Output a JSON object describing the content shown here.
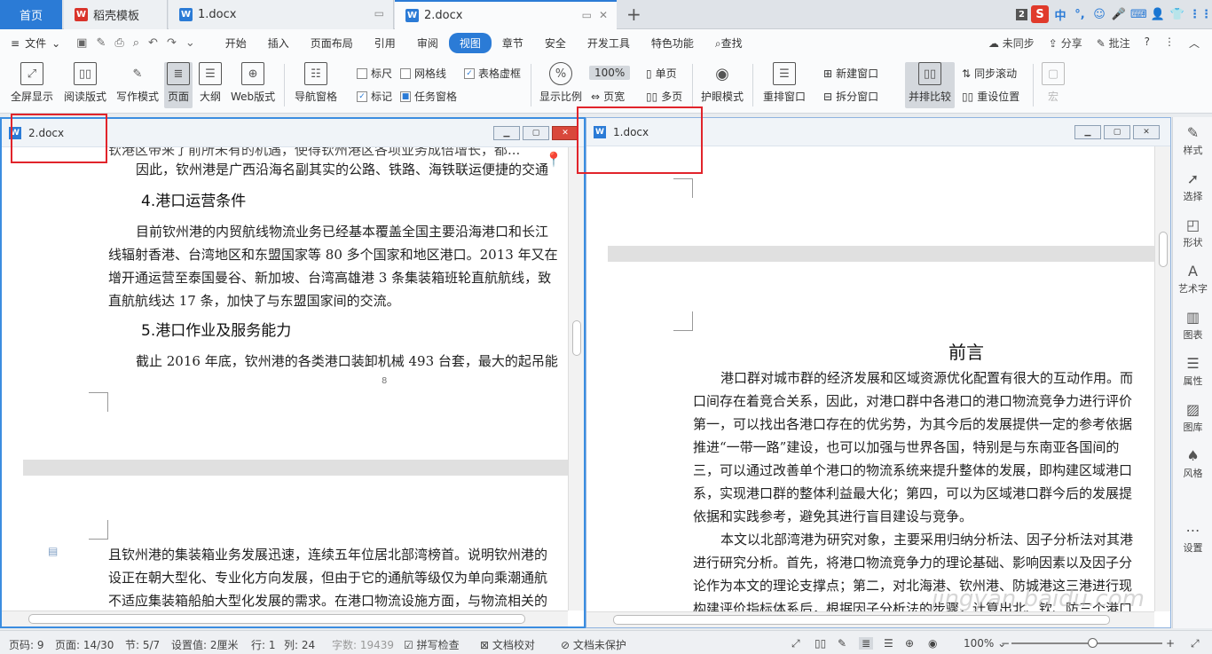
{
  "tabs": {
    "home": "首页",
    "template": "稻壳模板",
    "doc1": "1.docx",
    "doc2": "2.docx",
    "add": "+"
  },
  "tray": {
    "count": "2",
    "s": "S",
    "zh": "中",
    "punct": "°,",
    "emoji": "☺",
    "mic": "🎤",
    "kb": "⌨",
    "user": "👤",
    "shirt": "👕",
    "grid": "⋮⋮"
  },
  "menubar": {
    "file": "文件",
    "items": [
      "开始",
      "插入",
      "页面布局",
      "引用",
      "审阅",
      "视图",
      "章节",
      "安全",
      "开发工具",
      "特色功能"
    ],
    "search": "查找",
    "sync": "未同步",
    "share": "分享",
    "comment": "批注",
    "help": "?"
  },
  "ribbon": {
    "fullscreen": "全屏显示",
    "reading": "阅读版式",
    "writing": "写作模式",
    "page": "页面",
    "outline": "大纲",
    "web": "Web版式",
    "nav": "导航窗格",
    "ruler": "标尺",
    "gridline": "网格线",
    "tableline": "表格虚框",
    "mark": "标记",
    "taskpane": "任务窗格",
    "ratio": "显示比例",
    "zoom": "100%",
    "pagewidth": "页宽",
    "single": "单页",
    "multi": "多页",
    "eye": "护眼模式",
    "rearrange": "重排窗口",
    "newwin": "新建窗口",
    "split": "拆分窗口",
    "sidebyside": "并排比较",
    "syncscroll": "同步滚动",
    "resetpos": "重设位置",
    "macro": "宏"
  },
  "left_pane": {
    "title": "2.docx",
    "page_top_line1": "钦港区带来了前所未有的机遇，使得钦州港区各项业务成倍增长，都...",
    "page_top_line2": "因此，钦州港是广西沿海名副其实的公路、铁路、海铁联运便捷的交通",
    "heading4": "4.港口运营条件",
    "p4_1": "目前钦州港的内贸航线物流业务已经基本覆盖全国主要沿海港口和长江",
    "p4_2": "线辐射香港、台湾地区和东盟国家等 80 多个国家和地区港口。2013 年又在",
    "p4_3": "增开通运营至泰国曼谷、新加坡、台湾高雄港 3 条集装箱班轮直航航线，致",
    "p4_4": "直航航线达 17 条，加快了与东盟国家间的交流。",
    "heading5": "5.港口作业及服务能力",
    "p5_1": "截止 2016 年底，钦州港的各类港口装卸机械 493 台套，最大的起吊能",
    "pagenum": "8",
    "p6_1": "且钦州港的集装箱业务发展迅速，连续五年位居北部湾榜首。说明钦州港的",
    "p6_2": "设正在朝大型化、专业化方向发展，但由于它的通航等级仅为单向乘潮通航",
    "p6_3": "不适应集装箱船舶大型化发展的需求。在港口物流设施方面，与物流相关的"
  },
  "right_pane": {
    "title": "1.docx",
    "heading": "前言",
    "lines": [
      "港口群对城市群的经济发展和区域资源优化配置有很大的互动作用。而",
      "口间存在着竞合关系，因此，对港口群中各港口的港口物流竞争力进行评价",
      "第一，可以找出各港口存在的优劣势，为其今后的发展提供一定的参考依据",
      "推进“一带一路”建设，也可以加强与世界各国，特别是与东南亚各国间的",
      "三，可以通过改善单个港口的物流系统来提升整体的发展，即构建区域港口",
      "系，实现港口群的整体利益最大化；第四，可以为区域港口群今后的发展提",
      "依据和实践参考，避免其进行盲目建设与竞争。",
      "本文以北部湾港为研究对象，主要采用归纳分析法、因子分析法对其港",
      "进行研究分析。首先，将港口物流竞争力的理论基础、影响因素以及因子分",
      "论作为本文的理论支撑点；第二，对北海港、钦州港、防城港这三港进行现",
      "构建评价指标体系后，根据因子分析法的步骤，计算出北、钦、防三个港口"
    ]
  },
  "sidebar": [
    "样式",
    "选择",
    "形状",
    "艺术字",
    "图表",
    "属性",
    "图库",
    "风格",
    "设置"
  ],
  "status": {
    "pageno": "页码: 9",
    "pages": "页面: 14/30",
    "section": "节: 5/7",
    "setting": "设置值: 2厘米",
    "row": "行: 1",
    "col": "列: 24",
    "words": "字数: 19439",
    "spell": "拼写检查",
    "proof": "文档校对",
    "protect": "文档未保护",
    "zoom": "100%",
    "minus": "−",
    "plus": "+"
  },
  "watermark": "jingyan.baidu.com"
}
